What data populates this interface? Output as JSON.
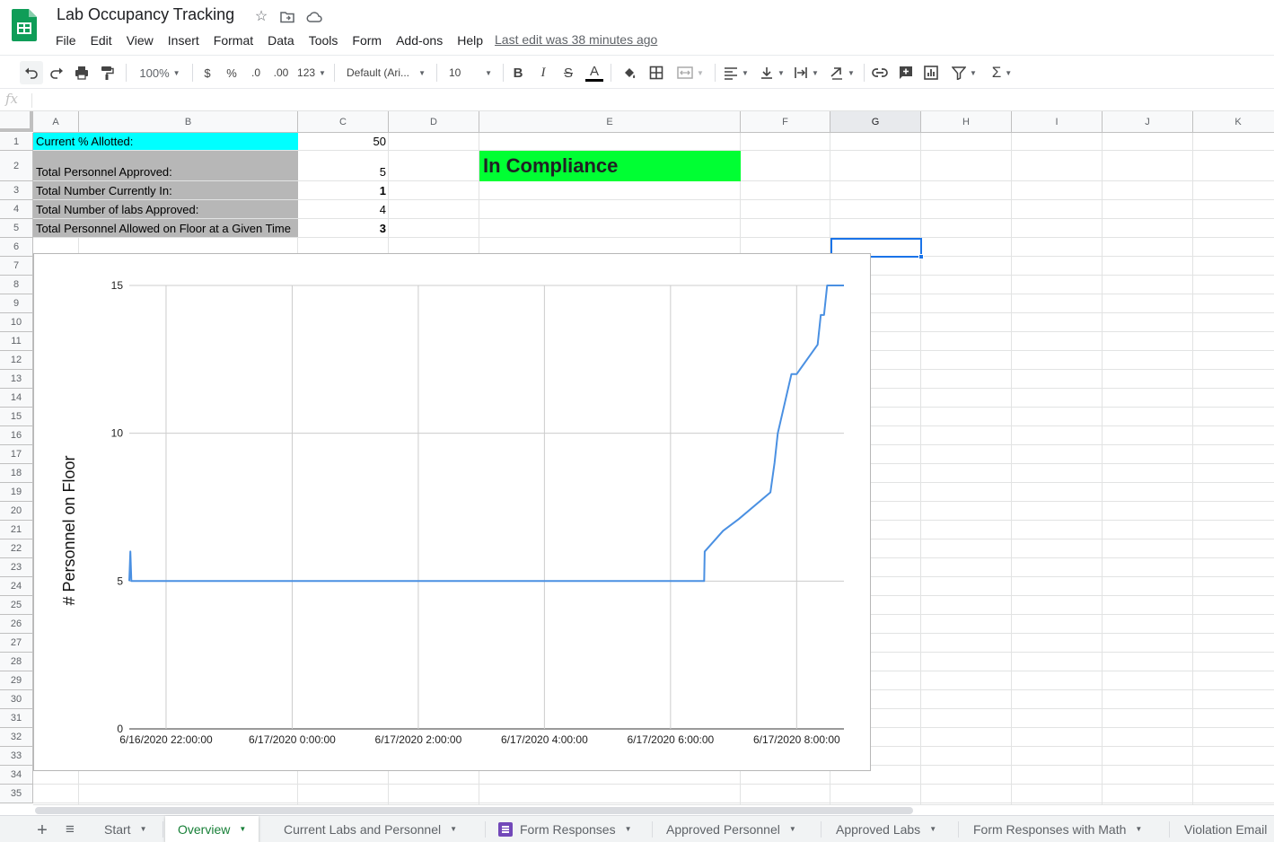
{
  "doc": {
    "title": "Lab Occupancy Tracking",
    "last_edit": "Last edit was 38 minutes ago",
    "menu": [
      "File",
      "Edit",
      "View",
      "Insert",
      "Format",
      "Data",
      "Tools",
      "Form",
      "Add-ons",
      "Help"
    ]
  },
  "toolbar": {
    "zoom": "100%",
    "currency": "$",
    "percent": "%",
    "decrease_decimal": ".0",
    "increase_decimal": ".00",
    "more_formats": "123",
    "font": "Default (Ari...",
    "font_size": "10",
    "bold": "B",
    "italic": "I",
    "strike": "S",
    "text_color": "A",
    "functions": "Σ"
  },
  "formula_bar": {
    "fx": "fx",
    "value": ""
  },
  "grid": {
    "columns": [
      "A",
      "B",
      "C",
      "D",
      "E",
      "F",
      "G",
      "H",
      "I",
      "J",
      "K"
    ],
    "selected_column": "G",
    "rows": [
      "1",
      "2",
      "3",
      "4",
      "5",
      "6",
      "7",
      "8",
      "9",
      "10",
      "11",
      "12",
      "13",
      "14",
      "15",
      "16",
      "17",
      "18",
      "19",
      "20",
      "21",
      "22",
      "23",
      "24",
      "25",
      "26",
      "27",
      "28",
      "29",
      "30",
      "31",
      "32",
      "33",
      "34",
      "35"
    ],
    "cells": {
      "a1": "Current % Allotted:",
      "c1": "50",
      "a2": "Total Personnel Approved:",
      "c2": "5",
      "a3": "Total Number Currently In:",
      "c3": "1",
      "a4": "Total Number of labs Approved:",
      "c4": "4",
      "a5": "Total Personnel Allowed on Floor at a Given Time",
      "c5": "3",
      "e2": "In Compliance"
    },
    "colors": {
      "cyan": "#00ffff",
      "gray": "#b7b7b7",
      "green": "#00ff33"
    }
  },
  "chart_data": {
    "type": "line",
    "title": "",
    "xlabel": "",
    "ylabel": "# Personnel on Floor",
    "ylim": [
      0,
      15
    ],
    "yticks": [
      "0",
      "5",
      "10",
      "15"
    ],
    "xticks": [
      "6/16/2020 22:00:00",
      "6/17/2020 0:00:00",
      "6/17/2020 2:00:00",
      "6/17/2020 4:00:00",
      "6/17/2020 6:00:00",
      "6/17/2020 8:00:00"
    ],
    "xlim": [
      "6/16/2020 21:25:00",
      "6/17/2020 8:45:00"
    ],
    "line_color": "#4a90e2",
    "grid": true,
    "series": [
      {
        "x": [
          "6/16/2020 21:25:00",
          "6/16/2020 21:26:00",
          "6/16/2020 21:27:00",
          "6/16/2020 21:28:00",
          "6/17/2020 6:32:00",
          "6/17/2020 6:32:30",
          "6/17/2020 6:50:00",
          "6/17/2020 7:05:00",
          "6/17/2020 7:35:00",
          "6/17/2020 7:39:00",
          "6/17/2020 7:42:00",
          "6/17/2020 7:55:00",
          "6/17/2020 8:00:00",
          "6/17/2020 8:20:00",
          "6/17/2020 8:23:00",
          "6/17/2020 8:26:00",
          "6/17/2020 8:29:00",
          "6/17/2020 8:45:00"
        ],
        "y": [
          5,
          6,
          5,
          5,
          5,
          6,
          6.7,
          7.1,
          8,
          9,
          10,
          12,
          12,
          13,
          14,
          14,
          15,
          15
        ]
      }
    ]
  },
  "sheet_tabs": {
    "add": "+",
    "list": "≡",
    "tabs": [
      "Start",
      "Overview",
      "Current Labs and Personnel",
      "Form Responses",
      "Approved Personnel",
      "Approved Labs",
      "Form Responses with Math",
      "Violation Email"
    ],
    "active": "Overview"
  }
}
